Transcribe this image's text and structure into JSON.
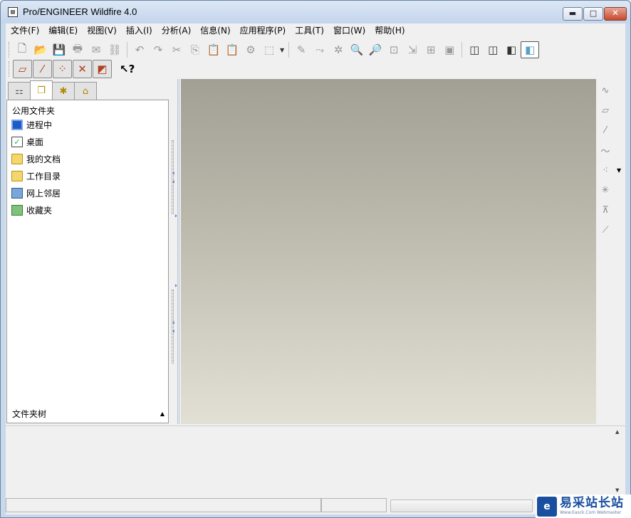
{
  "window": {
    "title": "Pro/ENGINEER Wildfire 4.0",
    "icon": "pro-e-app-icon"
  },
  "window_controls": {
    "minimize": "▬",
    "maximize": "□",
    "close": "✕"
  },
  "menu": [
    {
      "id": "file",
      "label": "文件(F)"
    },
    {
      "id": "edit",
      "label": "编辑(E)"
    },
    {
      "id": "view",
      "label": "视图(V)"
    },
    {
      "id": "insert",
      "label": "插入(I)"
    },
    {
      "id": "analysis",
      "label": "分析(A)"
    },
    {
      "id": "info",
      "label": "信息(N)"
    },
    {
      "id": "applications",
      "label": "应用程序(P)"
    },
    {
      "id": "tools",
      "label": "工具(T)"
    },
    {
      "id": "window",
      "label": "窗口(W)"
    },
    {
      "id": "help",
      "label": "帮助(H)"
    }
  ],
  "navigator": {
    "tabs": [
      {
        "name": "model-tree-tab",
        "icon": "model-tree-icon"
      },
      {
        "name": "folder-browser-tab",
        "icon": "folder-browser-icon",
        "active": true
      },
      {
        "name": "favorites-tab",
        "icon": "favorites-icon"
      },
      {
        "name": "connections-tab",
        "icon": "connections-icon"
      }
    ],
    "header": "公用文件夹",
    "items": [
      {
        "label": "进程中",
        "icon": "session-icon"
      },
      {
        "label": "桌面",
        "icon": "desktop-icon"
      },
      {
        "label": "我的文档",
        "icon": "my-documents-icon"
      },
      {
        "label": "工作目录",
        "icon": "working-directory-icon"
      },
      {
        "label": "网上邻居",
        "icon": "network-icon"
      },
      {
        "label": "收藏夹",
        "icon": "favorites-folder-icon"
      }
    ],
    "footer": "文件夹树"
  },
  "watermark": {
    "text": "易采站长站",
    "subtext": "Www.Easck.Com  Webmaster"
  }
}
